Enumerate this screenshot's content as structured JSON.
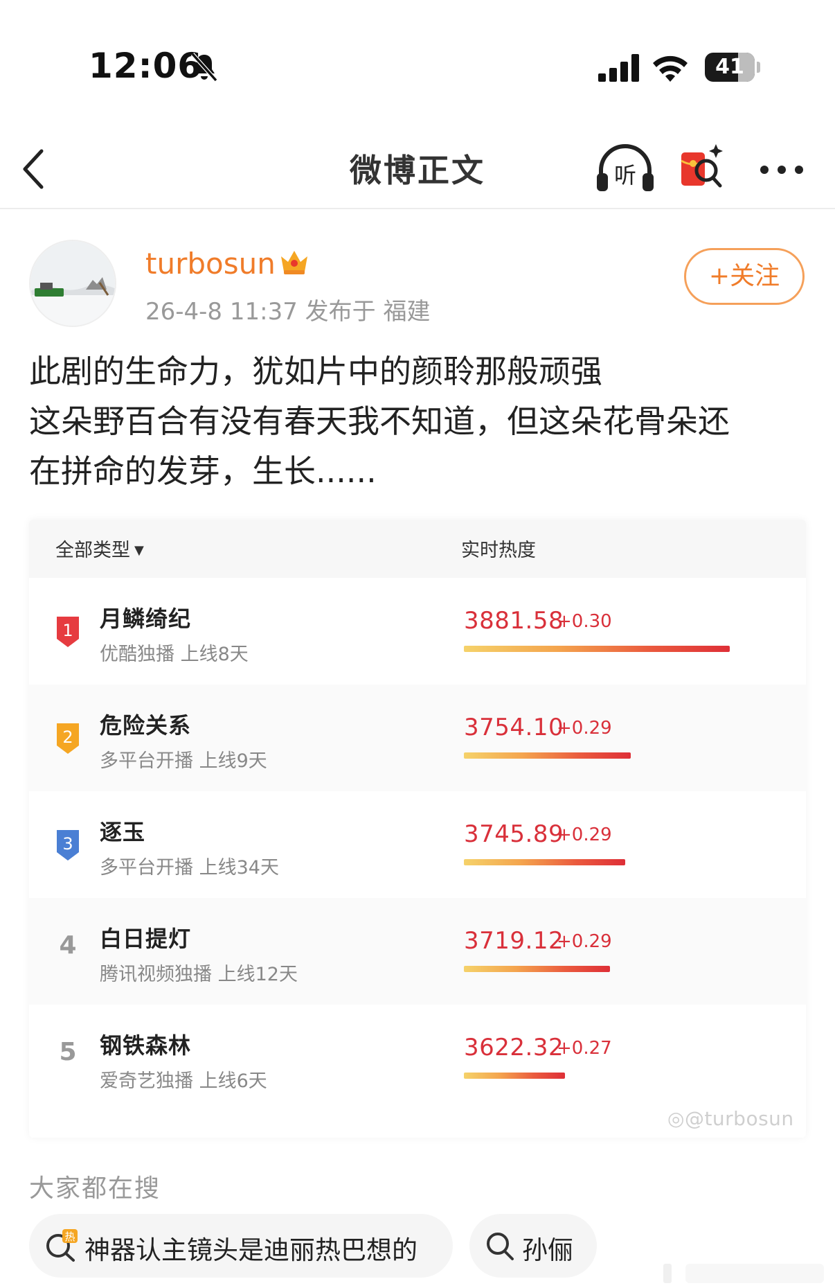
{
  "status_bar": {
    "time": "12:06",
    "battery": "41"
  },
  "nav": {
    "title": "微博正文"
  },
  "post": {
    "author": "turbosun",
    "meta": "26-4-8 11:37  发布于 福建",
    "follow_label": "+关注",
    "text_lines": [
      "此剧的生命力，犹如片中的颜聆那般顽强",
      "这朵野百合有没有春天我不知道，但这朵花骨朵还",
      "在拼命的发芽，生长......"
    ]
  },
  "ranking": {
    "header_type": "全部类型",
    "header_heat": "实时热度",
    "watermark": "@turbosun",
    "items": [
      {
        "rank": "1",
        "title": "月鳞绮纪",
        "subtitle": "优酷独播 上线8天",
        "heat": "3881.58",
        "delta": "+0.30",
        "bar": 3881.58,
        "badge_color": "#e63b40"
      },
      {
        "rank": "2",
        "title": "危险关系",
        "subtitle": "多平台开播 上线9天",
        "heat": "3754.10",
        "delta": "+0.29",
        "bar": 3754.1,
        "badge_color": "#f5a623"
      },
      {
        "rank": "3",
        "title": "逐玉",
        "subtitle": "多平台开播 上线34天",
        "heat": "3745.89",
        "delta": "+0.29",
        "bar": 3745.89,
        "badge_color": "#4a7fd4"
      },
      {
        "rank": "4",
        "title": "白日提灯",
        "subtitle": "腾讯视频独播 上线12天",
        "heat": "3719.12",
        "delta": "+0.29",
        "bar": 3719.12,
        "badge_color": ""
      },
      {
        "rank": "5",
        "title": "钢铁森林",
        "subtitle": "爱奇艺独播 上线6天",
        "heat": "3622.32",
        "delta": "+0.27",
        "bar": 3622.32,
        "badge_color": ""
      }
    ]
  },
  "search": {
    "heading": "大家都在搜",
    "chips": [
      "神器认主镜头是迪丽热巴想的",
      "孙俪"
    ]
  }
}
